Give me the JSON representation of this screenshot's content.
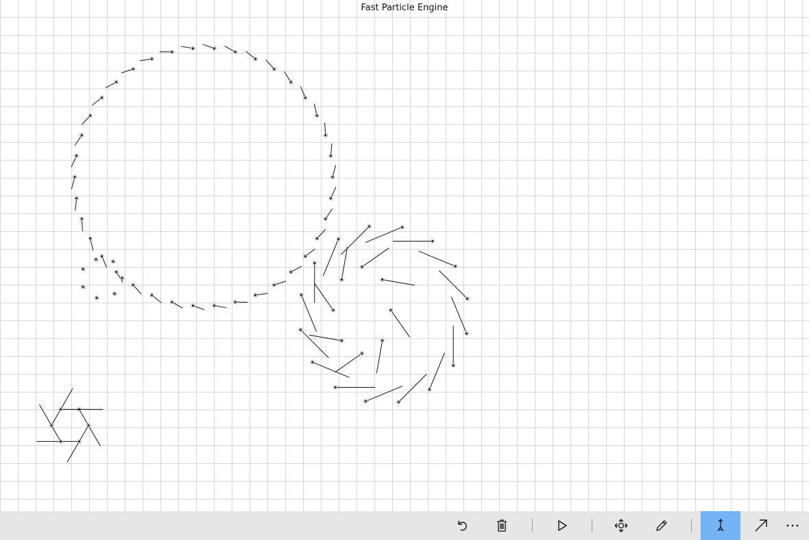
{
  "window": {
    "title": "Fast Particle Engine"
  },
  "toolbar": {
    "buttons": [
      {
        "name": "undo-button",
        "icon": "undo-icon",
        "label": "Undo"
      },
      {
        "name": "delete-button",
        "icon": "trash-icon",
        "label": "Delete"
      },
      {
        "name": "play-button",
        "icon": "play-icon",
        "label": "Play"
      },
      {
        "name": "move-button",
        "icon": "move-icon",
        "label": "Move"
      },
      {
        "name": "draw-button",
        "icon": "pencil-icon",
        "label": "Draw"
      },
      {
        "name": "particle-velocity-button",
        "icon": "particle-arrow-icon",
        "label": "Particle velocity",
        "active": true
      },
      {
        "name": "vector-button",
        "icon": "diagonal-arrow-icon",
        "label": "Vector"
      },
      {
        "name": "more-button",
        "icon": "ellipsis-icon",
        "label": "More"
      }
    ],
    "active_color": "#75b3f7",
    "background_color": "#e6e6e6"
  },
  "canvas": {
    "grid_color": "#d6d6d6",
    "particle_groups": [
      {
        "name": "big-ring",
        "count": 38,
        "rotation_deg": 15,
        "tail_length": 18
      },
      {
        "name": "inner-ring",
        "count": 8,
        "rotation_deg": 35,
        "tail_length": 48
      },
      {
        "name": "outer-ring",
        "count": 16,
        "rotation_deg": 35,
        "tail_length": 58
      },
      {
        "name": "small-pinwheel",
        "count": 6,
        "rotation_deg": 30,
        "tail_length": 62
      },
      {
        "name": "cluster",
        "count": 7,
        "rotation_deg": 0,
        "tail_length": 4
      }
    ]
  }
}
